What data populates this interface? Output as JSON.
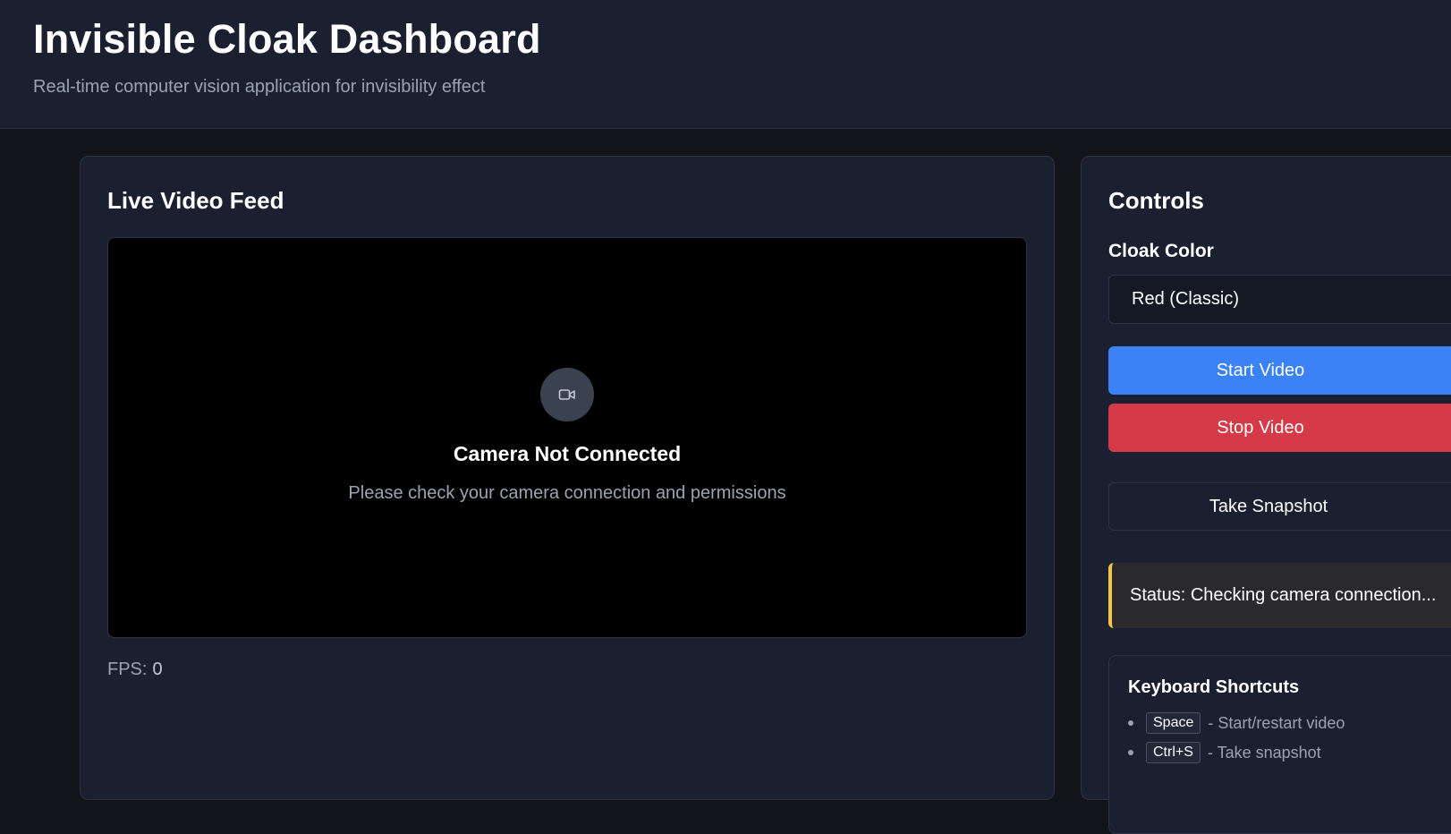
{
  "header": {
    "title": "Invisible Cloak Dashboard",
    "subtitle": "Real-time computer vision application for invisibility effect"
  },
  "video": {
    "title": "Live Video Feed",
    "placeholder_title": "Camera Not Connected",
    "placeholder_message": "Please check your camera connection and permissions",
    "camera_icon": "video-camera-icon",
    "fps_label": "FPS:",
    "fps_value": "0"
  },
  "controls": {
    "title": "Controls",
    "cloak_color_label": "Cloak Color",
    "cloak_color_selected": "Red (Classic)",
    "start_label": "Start Video",
    "stop_label": "Stop Video",
    "snapshot_label": "Take Snapshot",
    "status_text": "Status: Checking camera connection...",
    "colors": {
      "start": "#3b82f6",
      "stop": "#d63a47",
      "status_accent": "#f5c542"
    }
  },
  "shortcuts": {
    "title": "Keyboard Shortcuts",
    "items": [
      {
        "key": "Space",
        "desc": "- Start/restart video"
      },
      {
        "key": "Ctrl+S",
        "desc": "- Take snapshot"
      }
    ]
  }
}
